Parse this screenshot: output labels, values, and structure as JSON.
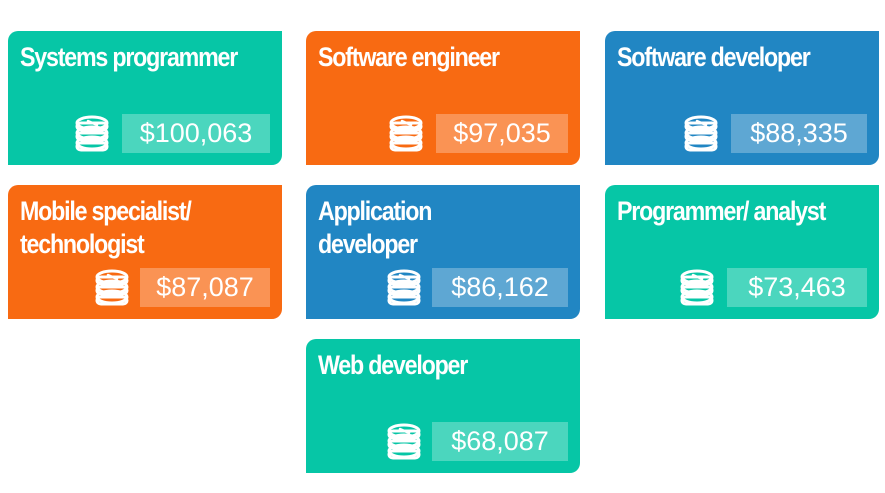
{
  "colors": {
    "teal": "#06c6a6",
    "orange": "#f86a12",
    "blue": "#2186c3"
  },
  "chart_data": {
    "type": "table",
    "categories": [
      "Systems programmer",
      "Software engineer",
      "Software developer",
      "Mobile specialist/ technologist",
      "Application developer",
      "Programmer/ analyst",
      "Web developer"
    ],
    "values": [
      100063,
      97035,
      88335,
      87087,
      86162,
      73463,
      68087
    ]
  },
  "cards": [
    {
      "title": "Systems programmer",
      "price": "$100,063",
      "color": "#06c6a6",
      "icon": "coin-stack-icon"
    },
    {
      "title": "Software engineer",
      "price": "$97,035",
      "color": "#f86a12",
      "icon": "coin-stack-icon"
    },
    {
      "title": "Software developer",
      "price": "$88,335",
      "color": "#2186c3",
      "icon": "coin-stack-icon"
    },
    {
      "title": "Mobile specialist/ technologist",
      "price": "$87,087",
      "color": "#f86a12",
      "icon": "coin-stack-icon"
    },
    {
      "title": "Application developer",
      "price": "$86,162",
      "color": "#2186c3",
      "icon": "coin-stack-icon"
    },
    {
      "title": "Programmer/ analyst",
      "price": "$73,463",
      "color": "#06c6a6",
      "icon": "coin-stack-icon"
    },
    {
      "title": "Web developer",
      "price": "$68,087",
      "color": "#06c6a6",
      "icon": "coin-stack-icon"
    }
  ]
}
